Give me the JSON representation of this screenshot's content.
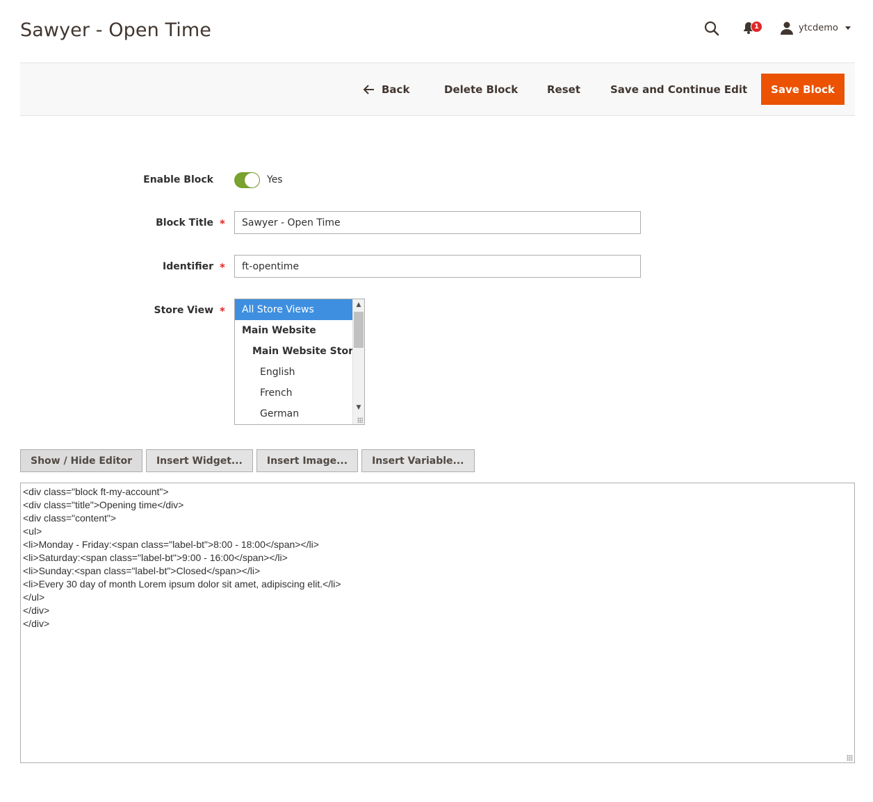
{
  "header": {
    "title": "Sawyer - Open Time",
    "notifications_count": "1",
    "username": "ytcdemo"
  },
  "actions": {
    "back": "Back",
    "delete": "Delete Block",
    "reset": "Reset",
    "save_continue": "Save and Continue Edit",
    "save": "Save Block"
  },
  "form": {
    "enable_label": "Enable Block",
    "enable_value": "Yes",
    "title_label": "Block Title",
    "title_value": "Sawyer - Open Time",
    "identifier_label": "Identifier",
    "identifier_value": "ft-opentime",
    "store_view_label": "Store View",
    "store_options": [
      "All Store Views",
      "Main Website",
      "Main Website Store",
      "English",
      "French",
      "German"
    ]
  },
  "editor": {
    "show_hide": "Show / Hide Editor",
    "insert_widget": "Insert Widget...",
    "insert_image": "Insert Image...",
    "insert_variable": "Insert Variable...",
    "content": "<div class=\"block ft-my-account\">\n<div class=\"title\">Opening time</div>\n<div class=\"content\">\n<ul>\n<li>Monday - Friday:<span class=\"label-bt\">8:00 - 18:00</span></li>\n<li>Saturday:<span class=\"label-bt\">9:00 - 16:00</span></li>\n<li>Sunday:<span class=\"label-bt\">Closed</span></li>\n<li>Every 30 day of month Lorem ipsum dolor sit amet, adipiscing elit.</li>\n</ul>\n</div>\n</div>"
  },
  "colors": {
    "primary_button": "#eb5202",
    "toggle_on": "#79a22e",
    "selected_option": "#3e8fe0",
    "required_star": "#e22626"
  }
}
